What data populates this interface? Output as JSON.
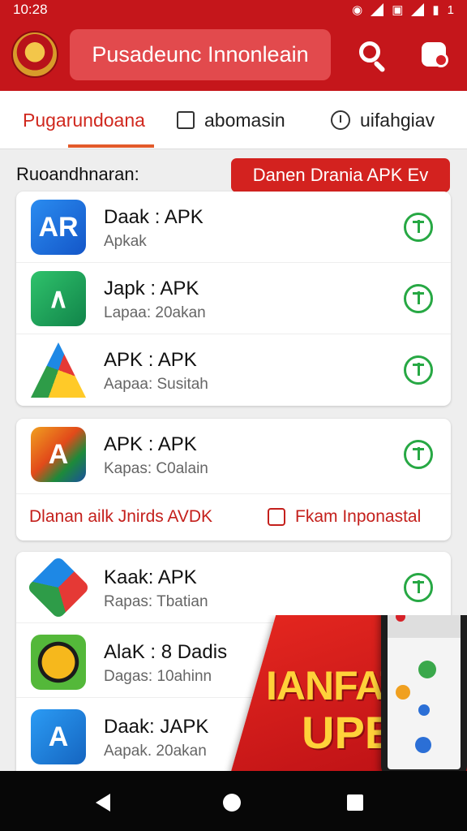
{
  "status_bar": {
    "time": "10:28",
    "battery": "1"
  },
  "app_bar": {
    "search_text": "Pusadeunc Innonleain"
  },
  "tabs": [
    {
      "label": "Pugarundoana",
      "icon": "none",
      "active": true
    },
    {
      "label": "abomasin",
      "icon": "checkbox-icon",
      "active": false
    },
    {
      "label": "uifahgiav",
      "icon": "clock-icon",
      "active": false
    }
  ],
  "section": {
    "title": "Ruoandhnaran:",
    "promo_button": "Danen Drania APK Ev"
  },
  "card1": {
    "apps": [
      {
        "name": "Daak : APK",
        "sub": "Apkak",
        "icon": "blue-ar-icon"
      },
      {
        "name": "Japk : APK",
        "sub": "Lapaa: 20akan",
        "icon": "green-app-icon"
      },
      {
        "name": "APK : APK",
        "sub": "Aapaa: Susitah",
        "icon": "multicolor-triangle-icon"
      }
    ]
  },
  "card2": {
    "apps": [
      {
        "name": "APK : APK",
        "sub": "Kapas: C0alain",
        "icon": "orange-a-icon"
      }
    ],
    "footer_left": "Dlanan ailk Jnirds AVDK",
    "footer_right": "Fkam Inponastal"
  },
  "card3": {
    "apps": [
      {
        "name": "Kaak: APK",
        "sub": "Rapas: Tbatian",
        "icon": "cube-icon"
      },
      {
        "name": "AlaK : 8 Dadis",
        "sub": "Dagas: 10ahinn",
        "icon": "yellow-game-icon"
      },
      {
        "name": "Daak: JAPK",
        "sub": "Aapak. 20akan",
        "icon": "blue-a-icon"
      }
    ]
  },
  "promo_overlay": {
    "line1": "IANFAT",
    "line2": "UPE"
  },
  "colors": {
    "primary": "#c5161b",
    "accent_green": "#27a844",
    "tab_active": "#d0281e"
  }
}
